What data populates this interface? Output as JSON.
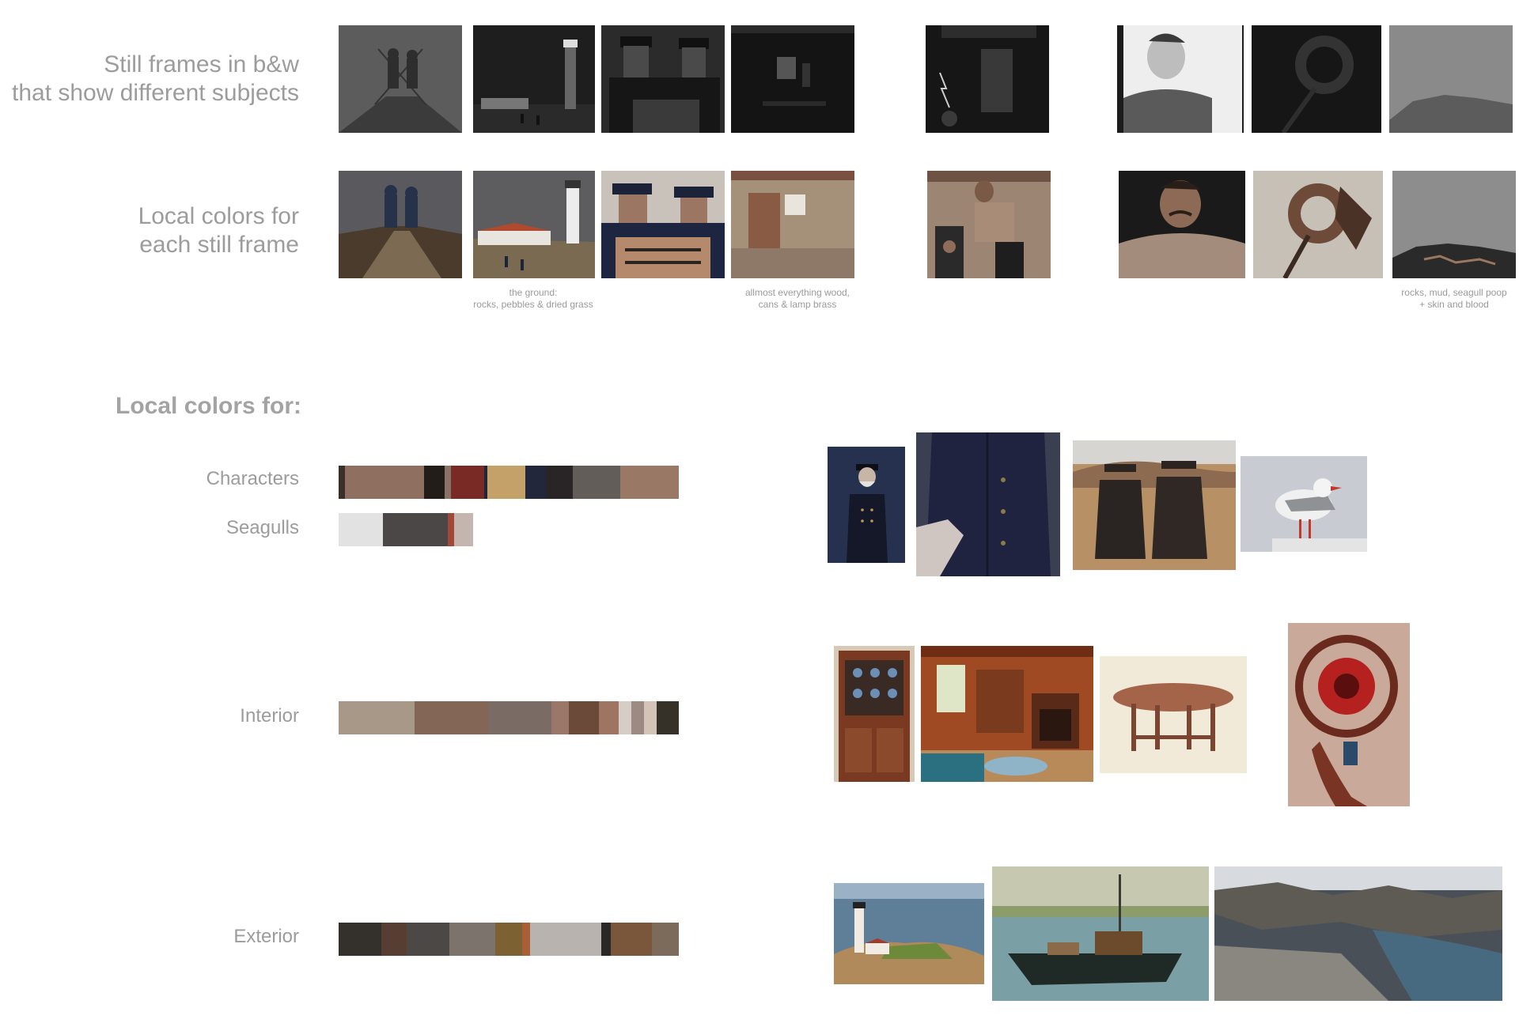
{
  "rows": {
    "bw_label": "Still frames in b&w\nthat show different subjects",
    "color_label": "Local colors for\neach still frame"
  },
  "captions": {
    "ground": "the ground:\nrocks, pebbles & dried grass",
    "wood": "allmost everything wood,\ncans & lamp brass",
    "rocks": "rocks, mud, seagull poop\n+ skin and blood"
  },
  "section_title": "Local colors for:",
  "palettes": {
    "characters": {
      "label": "Characters",
      "swatches": [
        "#3a302a",
        "#8f7060",
        "#8f7060",
        "#231d1a",
        "#8a7266",
        "#7a2a24",
        "#20253b",
        "#c3a169",
        "#22273c",
        "#292526",
        "#625d58",
        "#9a7866",
        "#9a7866"
      ]
    },
    "seagulls": {
      "label": "Seagulls",
      "swatches": [
        "#e2e2e2",
        "#4a4746",
        "#a2473c",
        "#c4b6ae"
      ]
    },
    "interior": {
      "label": "Interior",
      "swatches": [
        "#a89888",
        "#846657",
        "#7a6c64",
        "#9a7768",
        "#6c4a3a",
        "#9e7463",
        "#d6cdc6",
        "#9c8a83",
        "#d4c4b8",
        "#353129"
      ]
    },
    "exterior": {
      "label": "Exterior",
      "swatches": [
        "#34302c",
        "#563f32",
        "#4c4845",
        "#7c746c",
        "#7c6232",
        "#a85f36",
        "#b8b3ae",
        "#2a2826",
        "#7a563a",
        "#7c6a5a"
      ]
    }
  },
  "colors": {
    "text_gray": "#9c9c9c",
    "navy_coat": "#1f2340",
    "wood_brown": "#8c5a3c"
  },
  "icons": {
    "frames_bw": [
      "boat-bow-silhouettes",
      "lighthouse-night",
      "two-keepers-bw",
      "dark-interior",
      "lightning-figure",
      "man-portrait-bw",
      "rope-coil-dark",
      "misty-shore"
    ],
    "frames_color": [
      "boat-bow-color",
      "lighthouse-color",
      "two-keepers-color",
      "interior-wood",
      "man-at-stove",
      "man-portrait-color",
      "rope-coil-color",
      "rocky-shore"
    ],
    "photos": [
      "sea-captain",
      "navy-coat",
      "two-men-oilskins",
      "seagull",
      "dish-hutch",
      "colonial-room",
      "gateleg-table",
      "spiral-staircase",
      "lighthouse-island",
      "fishing-boat",
      "rocky-coast"
    ]
  }
}
